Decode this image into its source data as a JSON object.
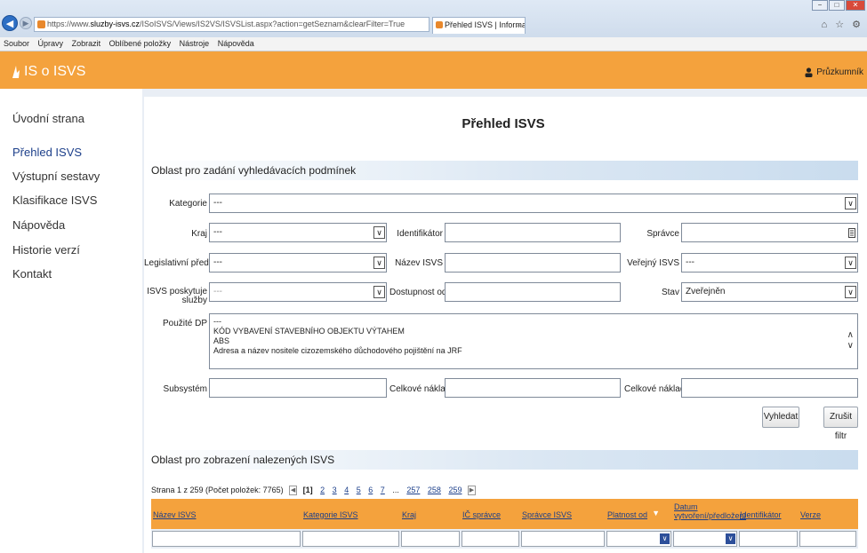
{
  "browser": {
    "url_prefix": "https://www.",
    "url_host": "sluzby-isvs.cz",
    "url_rest": "/ISoISVS/Views/IS2VS/ISVSList.aspx?action=getSeznam&clearFilter=True",
    "addr_tools": "⌕ ▾ 🔒 ↻",
    "tab_title": "Přehled ISVS | Informační s...",
    "tab_close": "×",
    "right_icons": "⌂ ☆ ⚙",
    "window_buttons": [
      "−",
      "□",
      "✕"
    ]
  },
  "menu": [
    "Soubor",
    "Úpravy",
    "Zobrazit",
    "Oblíbené položky",
    "Nástroje",
    "Nápověda"
  ],
  "app": {
    "logo_text": "IS o ISVS",
    "user_name": "Průzkumník"
  },
  "sidebar": {
    "items": [
      {
        "label": "Úvodní strana",
        "active": false
      },
      {
        "label": "Přehled ISVS",
        "active": true
      },
      {
        "label": "Výstupní sestavy",
        "active": false
      },
      {
        "label": "Klasifikace ISVS",
        "active": false
      },
      {
        "label": "Nápověda",
        "active": false
      },
      {
        "label": "Historie verzí",
        "active": false
      },
      {
        "label": "Kontakt",
        "active": false
      }
    ]
  },
  "main": {
    "title": "Přehled ISVS",
    "search_section_title": "Oblast pro zadání vyhledávacích podmínek",
    "results_section_title": "Oblast pro zobrazení nalezených ISVS"
  },
  "form": {
    "kategorie": {
      "label": "Kategorie",
      "value": "---"
    },
    "kraj": {
      "label": "Kraj",
      "value": "---"
    },
    "identifikator": {
      "label": "Identifikátor",
      "value": ""
    },
    "spravce": {
      "label": "Správce",
      "value": ""
    },
    "legislativni_predpis": {
      "label": "Legislativní předpis",
      "value": "---"
    },
    "nazev_isvs": {
      "label": "Název ISVS",
      "value": ""
    },
    "verejny_isvs": {
      "label": "Veřejný ISVS",
      "value": "---"
    },
    "isvs_poskytuje": {
      "label": "ISVS poskytuje služby",
      "value": "---"
    },
    "dostupnost_od_roku": {
      "label": "Dostupnost od roku",
      "value": ""
    },
    "stav": {
      "label": "Stav",
      "value": "Zveřejněn"
    },
    "pouzite_dp": {
      "label": "Použité DP",
      "options": [
        "---",
        "KÓD VYBAVENÍ STAVEBNÍHO OBJEKTU VÝTAHEM",
        "ABS",
        "Adresa a název nositele cizozemského důchodového pojištění na JRF"
      ]
    },
    "subsystem": {
      "label": "Subsystém",
      "value": ""
    },
    "celkove_naklady_od": {
      "label": "Celkové náklady od",
      "value": ""
    },
    "celkove_naklady_do": {
      "label": "Celkové náklady do",
      "value": ""
    },
    "search_button": "Vyhledat",
    "clear_button": "Zrušit filtr"
  },
  "pager": {
    "summary": "Strana 1 z 259 (Počet položek: 7765)",
    "current": "[1]",
    "pages": [
      "2",
      "3",
      "4",
      "5",
      "6",
      "7",
      "...",
      "257",
      "258",
      "259"
    ]
  },
  "table": {
    "columns": [
      "Název ISVS",
      "Kategorie ISVS",
      "Kraj",
      "IČ správce",
      "Správce ISVS",
      "Platnost od",
      "Datum vytvoření/předložení",
      "Identifikátor",
      "Verze"
    ]
  }
}
